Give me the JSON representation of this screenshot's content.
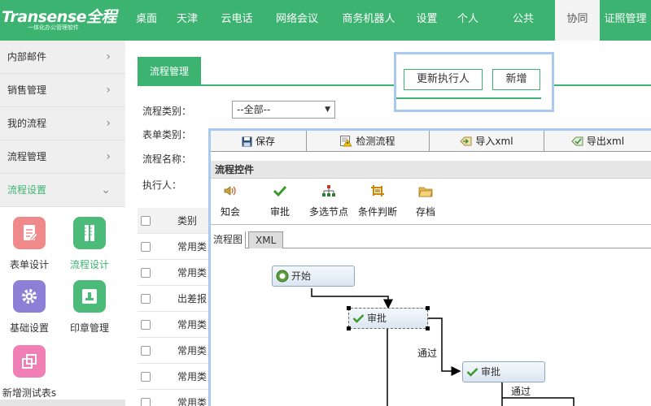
{
  "brand": {
    "name": "Transense全程",
    "tagline": "一体化办公管理软件"
  },
  "nav": [
    {
      "label": "桌面",
      "w": 50
    },
    {
      "label": "天津",
      "w": 50
    },
    {
      "label": "云电话",
      "w": 72
    },
    {
      "label": "网络会议",
      "w": 76
    },
    {
      "label": "商务机器人",
      "w": 100
    },
    {
      "label": "设置",
      "w": 43
    },
    {
      "label": "个人",
      "w": 58
    },
    {
      "label": "公共",
      "w": 78
    },
    {
      "label": "协同",
      "w": 55
    },
    {
      "label": "证照管理",
      "w": 63
    }
  ],
  "sidebar": {
    "items": [
      {
        "label": "内部邮件",
        "chev": "›"
      },
      {
        "label": "销售管理",
        "chev": "›"
      },
      {
        "label": "我的流程",
        "chev": "›"
      },
      {
        "label": "流程管理",
        "chev": "›"
      },
      {
        "label": "流程设置",
        "chev": "⌄"
      }
    ],
    "apps": [
      {
        "label": "表单设计"
      },
      {
        "label": "流程设计"
      },
      {
        "label": "基础设置"
      },
      {
        "label": "印章管理"
      },
      {
        "label": "新增测试表s"
      }
    ]
  },
  "main": {
    "tab": "流程管理",
    "form": {
      "type_label": "流程类别：",
      "type_value": "--全部--",
      "form_label": "表单类别：",
      "name_label": "流程名称：",
      "exec_label": "执行人："
    },
    "grid": {
      "header": "类别",
      "rows": [
        "常用类",
        "常用类",
        "出差报",
        "常用类",
        "常用类",
        "常用类",
        "常用类"
      ]
    }
  },
  "actions": {
    "update_exec": "更新执行人",
    "add": "新增"
  },
  "designer": {
    "toolbar": [
      {
        "label": "保存",
        "icon": "save-icon"
      },
      {
        "label": "检测流程",
        "icon": "check-flow-icon"
      },
      {
        "label": "导入xml",
        "icon": "import-icon"
      },
      {
        "label": "导出xml",
        "icon": "export-icon"
      }
    ],
    "controls_title": "流程控件",
    "controls": [
      {
        "label": "知会",
        "icon": "speaker-icon"
      },
      {
        "label": "审批",
        "icon": "checkmark-icon"
      },
      {
        "label": "多选节点",
        "icon": "tree-icon"
      },
      {
        "label": "条件判断",
        "icon": "condition-icon"
      },
      {
        "label": "存档",
        "icon": "folder-icon"
      }
    ],
    "view_tabs": [
      {
        "label": "流程图"
      },
      {
        "label": "XML"
      }
    ],
    "nodes": {
      "start": "开始",
      "approve1": "审批",
      "approve2": "审批",
      "edge1": "通过",
      "edge2": "通过"
    }
  },
  "colors": {
    "accent": "#3cb371",
    "dialog_border": "#a9c9ef"
  }
}
